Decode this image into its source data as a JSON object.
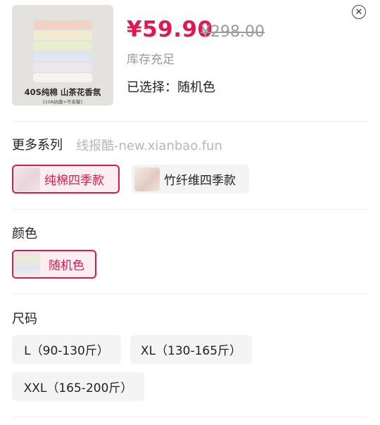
{
  "product": {
    "thumb_title": "40S纯棉 山茶花香氛",
    "thumb_subtitle": "[10A抗菌+不夹臀]",
    "price": "¥59.90",
    "original_price": "¥298.00",
    "stock_status": "库存充足",
    "selected_text": "已选择：随机色"
  },
  "close_icon": "close-icon",
  "series": {
    "title": "更多系列",
    "watermark": "线报酷-new.xianbao.fun",
    "options": [
      {
        "label": "纯棉四季款",
        "selected": true
      },
      {
        "label": "竹纤维四季款",
        "selected": false
      }
    ]
  },
  "color": {
    "title": "颜色",
    "options": [
      {
        "label": "随机色",
        "selected": true
      }
    ]
  },
  "size": {
    "title": "尺码",
    "options": [
      {
        "label": "L（90-130斤）",
        "selected": false
      },
      {
        "label": "XL（130-165斤）",
        "selected": false
      },
      {
        "label": "XXL（165-200斤）",
        "selected": false
      }
    ]
  },
  "colors": {
    "accent": "#e0184f",
    "chip_bg": "#f4f4f4",
    "muted_text": "#9a9a9a"
  }
}
